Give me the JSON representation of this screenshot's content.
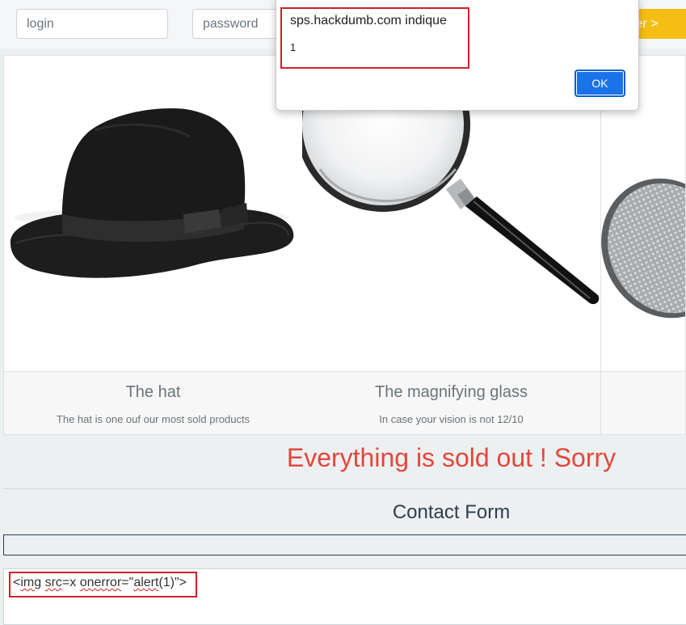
{
  "header": {
    "login_placeholder": "login",
    "password_placeholder": "password",
    "register_label": "ster >"
  },
  "products": [
    {
      "title": "The hat",
      "description": "The hat is one ouf our most sold products"
    },
    {
      "title": "The magnifying glass",
      "description": "In case your vision is not 12/10"
    }
  ],
  "notice": "Everything is sold out ! Sorry",
  "contact": {
    "title": "Contact Form",
    "message_value": "<img src=x onerror=\"alert(1)\">",
    "message_parts": [
      "<",
      "img",
      " ",
      "src",
      "=x ",
      "onerror",
      "=\"",
      "alert",
      "(1)\">"
    ]
  },
  "alert_dialog": {
    "origin": "sps.hackdumb.com indique",
    "message": "1",
    "ok_label": "OK"
  },
  "colors": {
    "accent": "#f6be12",
    "error": "#e2473b",
    "annotation": "#d0212a",
    "ok_button": "#1a73e8"
  }
}
